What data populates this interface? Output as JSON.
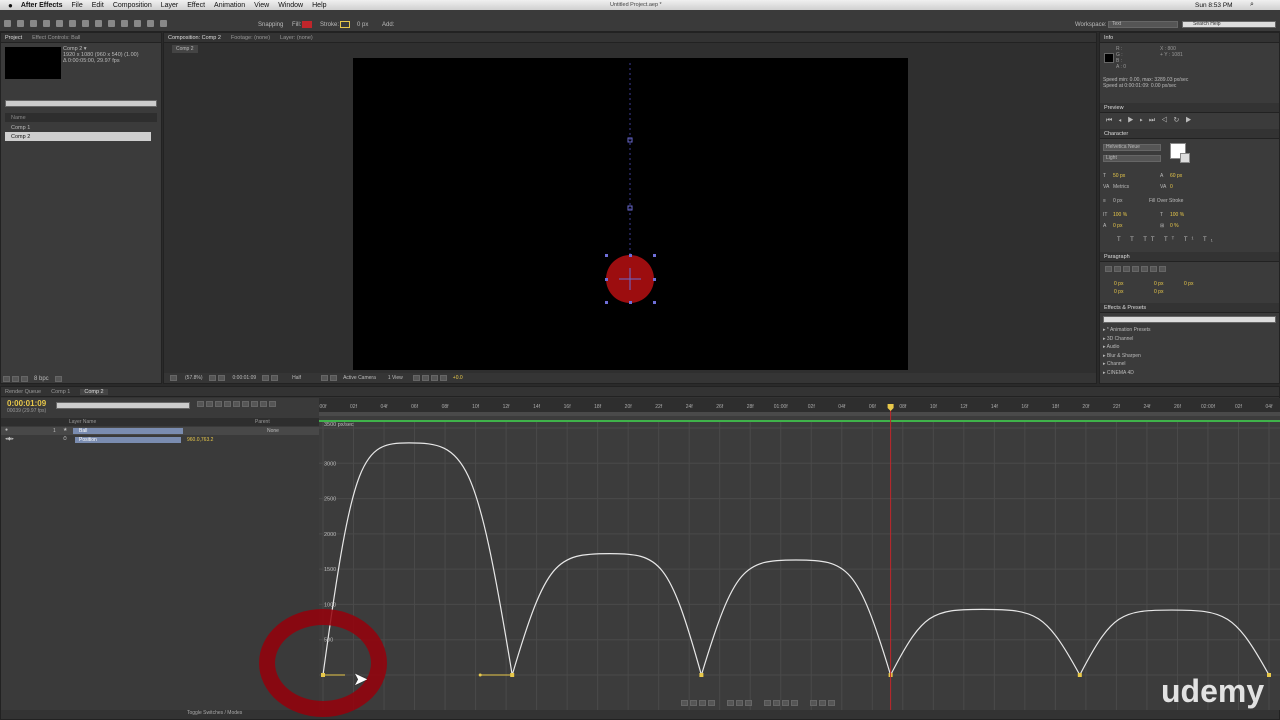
{
  "menubar": {
    "app": "After Effects",
    "items": [
      "File",
      "Edit",
      "Composition",
      "Layer",
      "Effect",
      "Animation",
      "View",
      "Window",
      "Help"
    ],
    "document_title": "Untitled Project.aep *",
    "clock": "Sun 8:53 PM"
  },
  "toolbar": {
    "snapping": "Snapping",
    "fill": "Fill:",
    "stroke": "Stroke:",
    "stroke_px": "0 px",
    "add": "Add:",
    "workspace_label": "Workspace:",
    "workspace_value": "Text",
    "search_help": "Search Help",
    "fill_color": "#c0262b",
    "stroke_color": "#e8c84a"
  },
  "project_panel": {
    "tab": "Project",
    "tab2": "Effect Controls: Ball",
    "comp_name": "Comp 2 ▾",
    "comp_size": "1920 x 1080  (960 x 540) (1.00)",
    "comp_duration": "Δ 0:00:05:00, 29.97 fps",
    "col_name": "Name",
    "items": [
      "Comp 1",
      "Comp 2"
    ],
    "bpc": "8 bpc"
  },
  "comp_panel": {
    "tab": "Composition: Comp 2",
    "footage": "Footage: (none)",
    "layer": "Layer: (none)",
    "sub_tab": "Comp 2",
    "zoom": "(57.8%)",
    "time": "0:00:01:09",
    "resolution": "Half",
    "camera": "Active Camera",
    "view": "1 View",
    "exposure": "+0.0",
    "ball_color": "#9c0d0f"
  },
  "info_panel": {
    "tab": "Info",
    "r": "R :",
    "g": "G :",
    "b": "B :",
    "a": "A : 0",
    "x": "X : 800",
    "y": "+ Y : 1081",
    "speed1": "Speed min: 0.00, max: 3289.03 px/sec",
    "speed2": "Speed at 0:00:01:09: 0.00 px/sec"
  },
  "preview_panel": {
    "tab": "Preview"
  },
  "character_panel": {
    "tab": "Character",
    "font": "Helvetica Neue",
    "style": "Light",
    "size": "50 px",
    "leading": "60 px",
    "kerning": "Metrics",
    "tracking": "0",
    "stroke_width": "0 px",
    "stroke_mode": "Fill Over Stroke",
    "v_scale": "100 %",
    "h_scale": "100 %",
    "baseline": "0 px",
    "tsume": "0 %",
    "styles": "T T TT Tᵀ T¹ T₁"
  },
  "paragraph_panel": {
    "tab": "Paragraph",
    "indent1": "0 px",
    "indent2": "0 px",
    "indent3": "0 px",
    "space1": "0 px",
    "space2": "0 px"
  },
  "effects_panel": {
    "tab": "Effects & Presets",
    "items": [
      "* Animation Presets",
      "3D Channel",
      "Audio",
      "Blur & Sharpen",
      "Channel",
      "CINEMA 4D"
    ]
  },
  "timeline": {
    "tabs": [
      "Render Queue",
      "Comp 1",
      "Comp 2"
    ],
    "timecode": "0:00:01:09",
    "frame_info": "00039 (29.97 fps)",
    "col_layer": "Layer Name",
    "col_parent": "Parent",
    "layer_num": "1",
    "layer_name": "Ball",
    "parent_value": "None",
    "prop_name": "Position",
    "prop_value": "960.0,763.2",
    "toggle": "Toggle Switches / Modes",
    "ruler": [
      "00f",
      "02f",
      "04f",
      "06f",
      "08f",
      "10f",
      "12f",
      "14f",
      "16f",
      "18f",
      "20f",
      "22f",
      "24f",
      "26f",
      "28f",
      "01:00f",
      "02f",
      "04f",
      "06f",
      "08f",
      "10f",
      "12f",
      "14f",
      "16f",
      "18f",
      "20f",
      "22f",
      "24f",
      "26f",
      "02:00f",
      "02f",
      "04f"
    ],
    "graph_unit": "3500 px/sec",
    "graph_ticks": [
      "3000",
      "2500",
      "2000",
      "1500",
      "1000",
      "500"
    ]
  },
  "chart_data": {
    "type": "line",
    "ylabel": "px/sec",
    "ylim": [
      0,
      3500
    ],
    "series": [
      {
        "points": [
          [
            0,
            0
          ],
          [
            3,
            3289
          ],
          [
            6.6,
            0
          ],
          [
            10,
            1720
          ],
          [
            13.2,
            0
          ],
          [
            16.5,
            1630
          ],
          [
            19.8,
            0
          ],
          [
            23,
            930
          ],
          [
            26.4,
            0
          ],
          [
            29.6,
            920
          ],
          [
            33,
            0
          ]
        ]
      }
    ],
    "current_time_marker": 19.8
  },
  "watermark": "udemy"
}
